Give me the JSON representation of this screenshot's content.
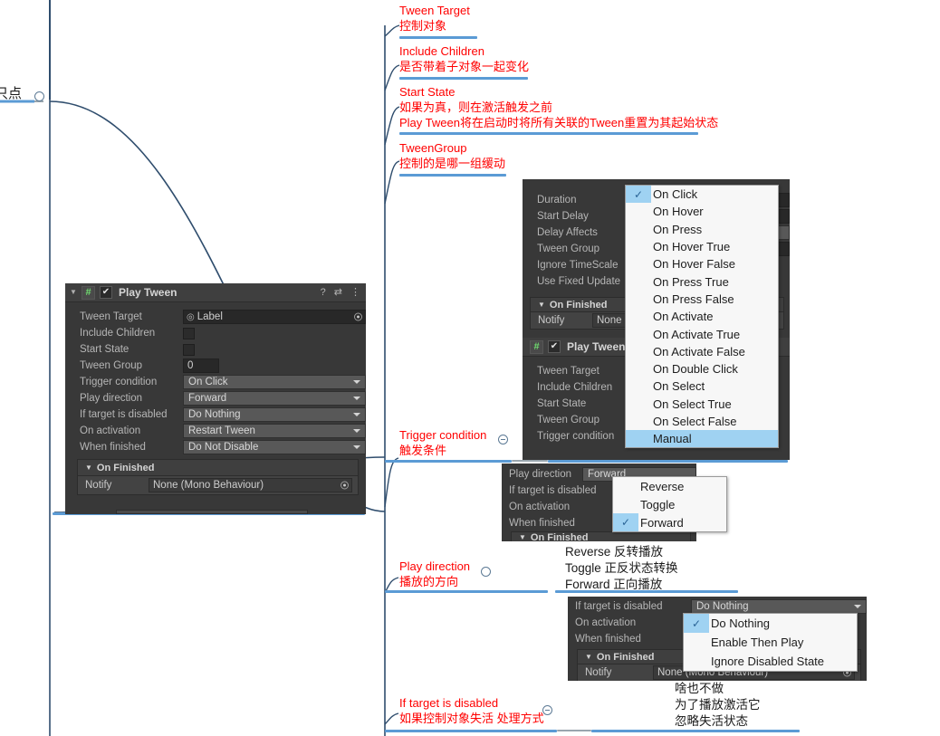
{
  "mindmap": {
    "root_note": "只点",
    "notes": [
      {
        "id": "tween-target",
        "en": "Tween Target",
        "cn": "控制对象"
      },
      {
        "id": "include-children",
        "en": "Include Children",
        "cn": "是否带着子对象一起变化"
      },
      {
        "id": "start-state",
        "en": "Start State",
        "cn": "如果为真，则在激活触发之前",
        "cn2": "Play Tween将在启动时将所有关联的Tween重置为其起始状态"
      },
      {
        "id": "tween-group",
        "en": "TweenGroup",
        "cn": "控制的是哪一组缓动"
      },
      {
        "id": "trigger-condition",
        "en": "Trigger condition",
        "cn": "触发条件"
      },
      {
        "id": "play-direction",
        "en": "Play direction",
        "cn": "播放的方向"
      },
      {
        "id": "if-target-disabled",
        "en": "If target is disabled",
        "cn": "如果控制对象失活 处理方式"
      }
    ],
    "play_direction_legend": [
      "Reverse 反转播放",
      "Toggle 正反状态转换",
      "Forward 正向播放"
    ],
    "if_disabled_legend": [
      "啥也不做",
      "为了播放激活它",
      "忽略失活状态"
    ]
  },
  "inspector": {
    "component_title": "Play Tween",
    "enabled_check": "✔",
    "script_glyph": "#",
    "foldout_glyph": "▼",
    "tools": {
      "help": "?",
      "preset": "⇄",
      "menu": "⋮"
    },
    "fields": [
      {
        "label": "Tween Target",
        "type": "object",
        "value": "Label"
      },
      {
        "label": "Include Children",
        "type": "checkbox",
        "value": ""
      },
      {
        "label": "Start State",
        "type": "checkbox",
        "value": ""
      },
      {
        "label": "Tween Group",
        "type": "number",
        "value": "0"
      },
      {
        "label": "Trigger condition",
        "type": "popup",
        "value": "On Click"
      },
      {
        "label": "Play direction",
        "type": "popup",
        "value": "Forward"
      },
      {
        "label": "If target is disabled",
        "type": "popup",
        "value": "Do Nothing"
      },
      {
        "label": "On activation",
        "type": "popup",
        "value": "Restart Tween"
      },
      {
        "label": "When finished",
        "type": "popup",
        "value": "Do Not Disable"
      }
    ],
    "event": {
      "header": "On Finished",
      "header_glyph": "▼",
      "notify_label": "Notify",
      "notify_value": "None (Mono Behaviour)"
    }
  },
  "panel_trigger": {
    "tween_rows": [
      "Duration",
      "Start Delay",
      "Delay Affects",
      "Tween Group",
      "Ignore TimeScale",
      "Use Fixed Update"
    ],
    "event_header": "On Finished",
    "notify_label": "Notify",
    "notify_value": "None",
    "component_title": "Play Tween",
    "play_rows": [
      "Tween Target",
      "Include Children",
      "Start State",
      "Tween Group",
      "Trigger condition"
    ],
    "menu_items": [
      {
        "label": "On Click",
        "checked": true,
        "selected": false
      },
      {
        "label": "On Hover",
        "checked": false,
        "selected": false
      },
      {
        "label": "On Press",
        "checked": false,
        "selected": false
      },
      {
        "label": "On Hover True",
        "checked": false,
        "selected": false
      },
      {
        "label": "On Hover False",
        "checked": false,
        "selected": false
      },
      {
        "label": "On Press True",
        "checked": false,
        "selected": false
      },
      {
        "label": "On Press False",
        "checked": false,
        "selected": false
      },
      {
        "label": "On Activate",
        "checked": false,
        "selected": false
      },
      {
        "label": "On Activate True",
        "checked": false,
        "selected": false
      },
      {
        "label": "On Activate False",
        "checked": false,
        "selected": false
      },
      {
        "label": "On Double Click",
        "checked": false,
        "selected": false
      },
      {
        "label": "On Select",
        "checked": false,
        "selected": false
      },
      {
        "label": "On Select True",
        "checked": false,
        "selected": false
      },
      {
        "label": "On Select False",
        "checked": false,
        "selected": false
      },
      {
        "label": "Manual",
        "checked": false,
        "selected": true
      }
    ]
  },
  "panel_direction": {
    "rows": [
      {
        "label": "Play direction",
        "value": "Forward"
      },
      {
        "label": "If target is disabled",
        "value": ""
      },
      {
        "label": "On activation",
        "value": ""
      },
      {
        "label": "When finished",
        "value": ""
      }
    ],
    "event_header": "On Finished",
    "menu_items": [
      {
        "label": "Reverse",
        "checked": false
      },
      {
        "label": "Toggle",
        "checked": false
      },
      {
        "label": "Forward",
        "checked": true
      }
    ]
  },
  "panel_disabled": {
    "rows": [
      {
        "label": "If target is disabled",
        "value": "Do Nothing"
      },
      {
        "label": "On activation",
        "value": ""
      },
      {
        "label": "When finished",
        "value": ""
      }
    ],
    "event_header": "On Finished",
    "notify_label": "Notify",
    "notify_value": "None (Mono Behaviour)",
    "menu_items": [
      {
        "label": "Do Nothing",
        "checked": true
      },
      {
        "label": "Enable Then Play",
        "checked": false
      },
      {
        "label": "Ignore Disabled State",
        "checked": false
      }
    ]
  },
  "colors": {
    "note_red": "#ff0000",
    "branch_blue": "#5b9bd5",
    "unity_bg": "#383838",
    "menu_highlight": "#9fd2f2"
  }
}
